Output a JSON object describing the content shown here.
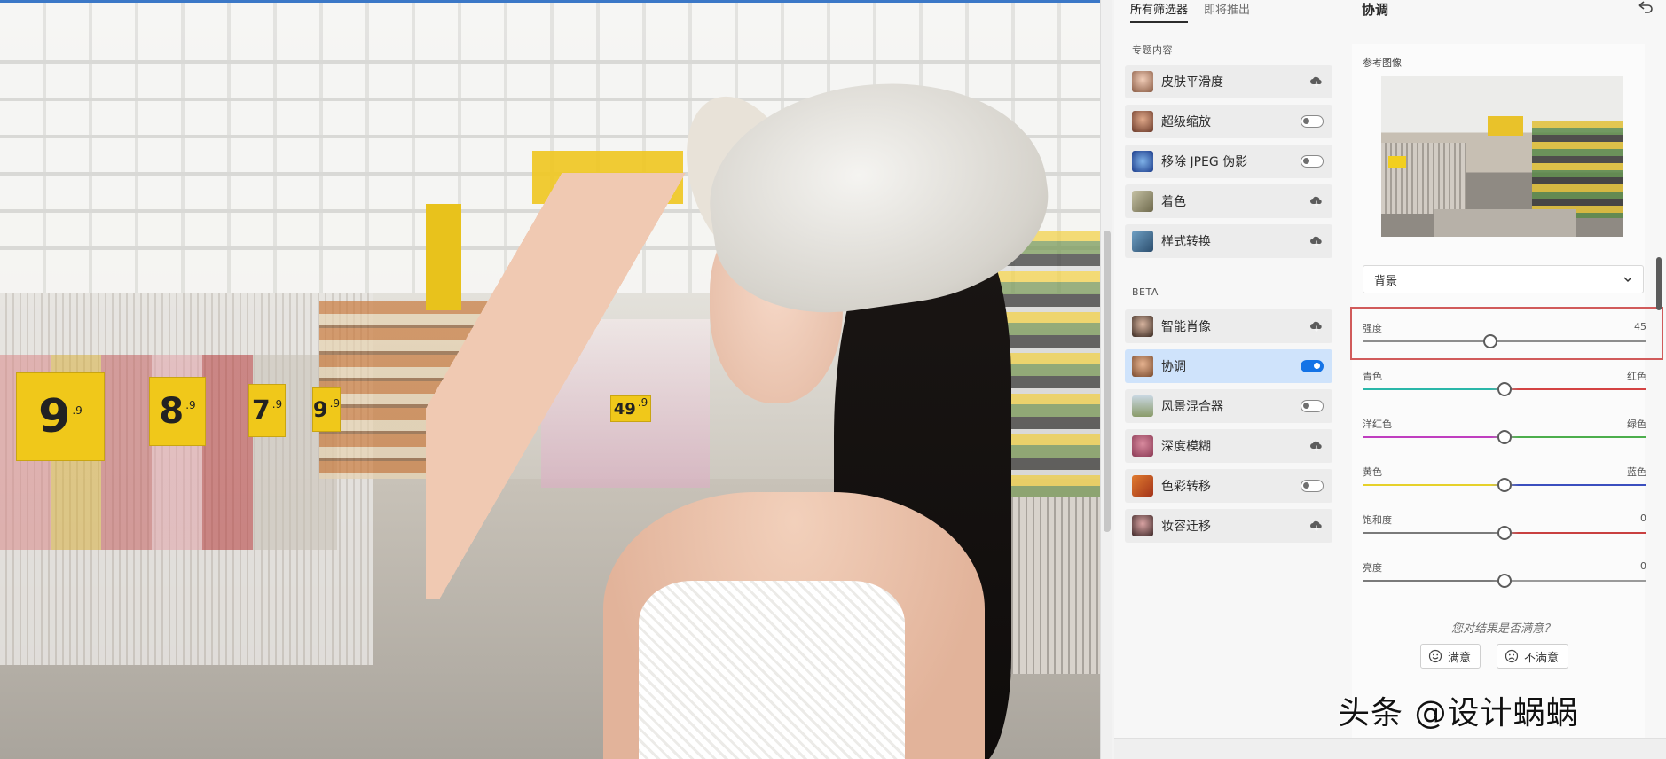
{
  "filters_panel": {
    "tabs": [
      "所有筛选器",
      "即将推出"
    ],
    "sections": {
      "featured_title": "专题内容",
      "beta_title": "BETA"
    },
    "featured": [
      {
        "label": "皮肤平滑度",
        "control": "download",
        "icon": "skin-smoothing-thumb"
      },
      {
        "label": "超级缩放",
        "control": "toggle-off",
        "icon": "super-zoom-thumb"
      },
      {
        "label": "移除 JPEG 伪影",
        "control": "toggle-off",
        "icon": "jpeg-artifact-thumb"
      },
      {
        "label": "着色",
        "control": "download",
        "icon": "colorize-thumb"
      },
      {
        "label": "样式转换",
        "control": "download",
        "icon": "style-transfer-thumb"
      }
    ],
    "beta": [
      {
        "label": "智能肖像",
        "control": "download",
        "icon": "smart-portrait-thumb"
      },
      {
        "label": "协调",
        "control": "toggle-on",
        "icon": "harmonization-thumb",
        "active": true
      },
      {
        "label": "风景混合器",
        "control": "toggle-off",
        "icon": "landscape-mixer-thumb"
      },
      {
        "label": "深度模糊",
        "control": "download",
        "icon": "depth-blur-thumb"
      },
      {
        "label": "色彩转移",
        "control": "toggle-off",
        "icon": "color-transfer-thumb"
      },
      {
        "label": "妆容迁移",
        "control": "download",
        "icon": "makeup-transfer-thumb"
      }
    ]
  },
  "properties": {
    "title": "协调",
    "reference_label": "参考图像",
    "layer_select": "背景",
    "sliders": [
      {
        "label": "强度",
        "right_label": "45",
        "value": 45,
        "min": 0,
        "max": 100,
        "track": "#8d8d8d"
      },
      {
        "label": "青色",
        "right_label": "红色",
        "value": 0,
        "min": -50,
        "max": 50,
        "gradient": [
          "#2ab7a9",
          "#d44343"
        ]
      },
      {
        "label": "洋红色",
        "right_label": "绿色",
        "value": 0,
        "min": -50,
        "max": 50,
        "gradient": [
          "#c03ec0",
          "#4cae4c"
        ]
      },
      {
        "label": "黄色",
        "right_label": "蓝色",
        "value": 0,
        "min": -50,
        "max": 50,
        "gradient": [
          "#e6d12a",
          "#3b4fbf"
        ]
      },
      {
        "label": "饱和度",
        "right_label": "0",
        "value": 0,
        "min": -50,
        "max": 50,
        "gradient": [
          "#7a7a7a",
          "#c94040"
        ]
      },
      {
        "label": "亮度",
        "right_label": "0",
        "value": 0,
        "min": -50,
        "max": 50,
        "gradient": [
          "#7a7a7a",
          "#9a9a9a"
        ]
      }
    ],
    "feedback": {
      "question": "您对结果是否满意？",
      "satisfied": "满意",
      "unsatisfied": "不满意"
    }
  },
  "canvas": {
    "price_tags": [
      {
        "main": "9",
        "sup": ".9"
      },
      {
        "main": "8",
        "sup": ".9"
      },
      {
        "main": "7",
        "sup": ".9"
      },
      {
        "main": "9",
        "sup": ".9"
      },
      {
        "main": "49",
        "sup": ".9"
      }
    ]
  },
  "watermark": "头条 @设计蜗蜗",
  "colors": {
    "accent": "#1473e6",
    "highlight_box": "#d15b5b",
    "active_row": "#cfe3fb"
  }
}
